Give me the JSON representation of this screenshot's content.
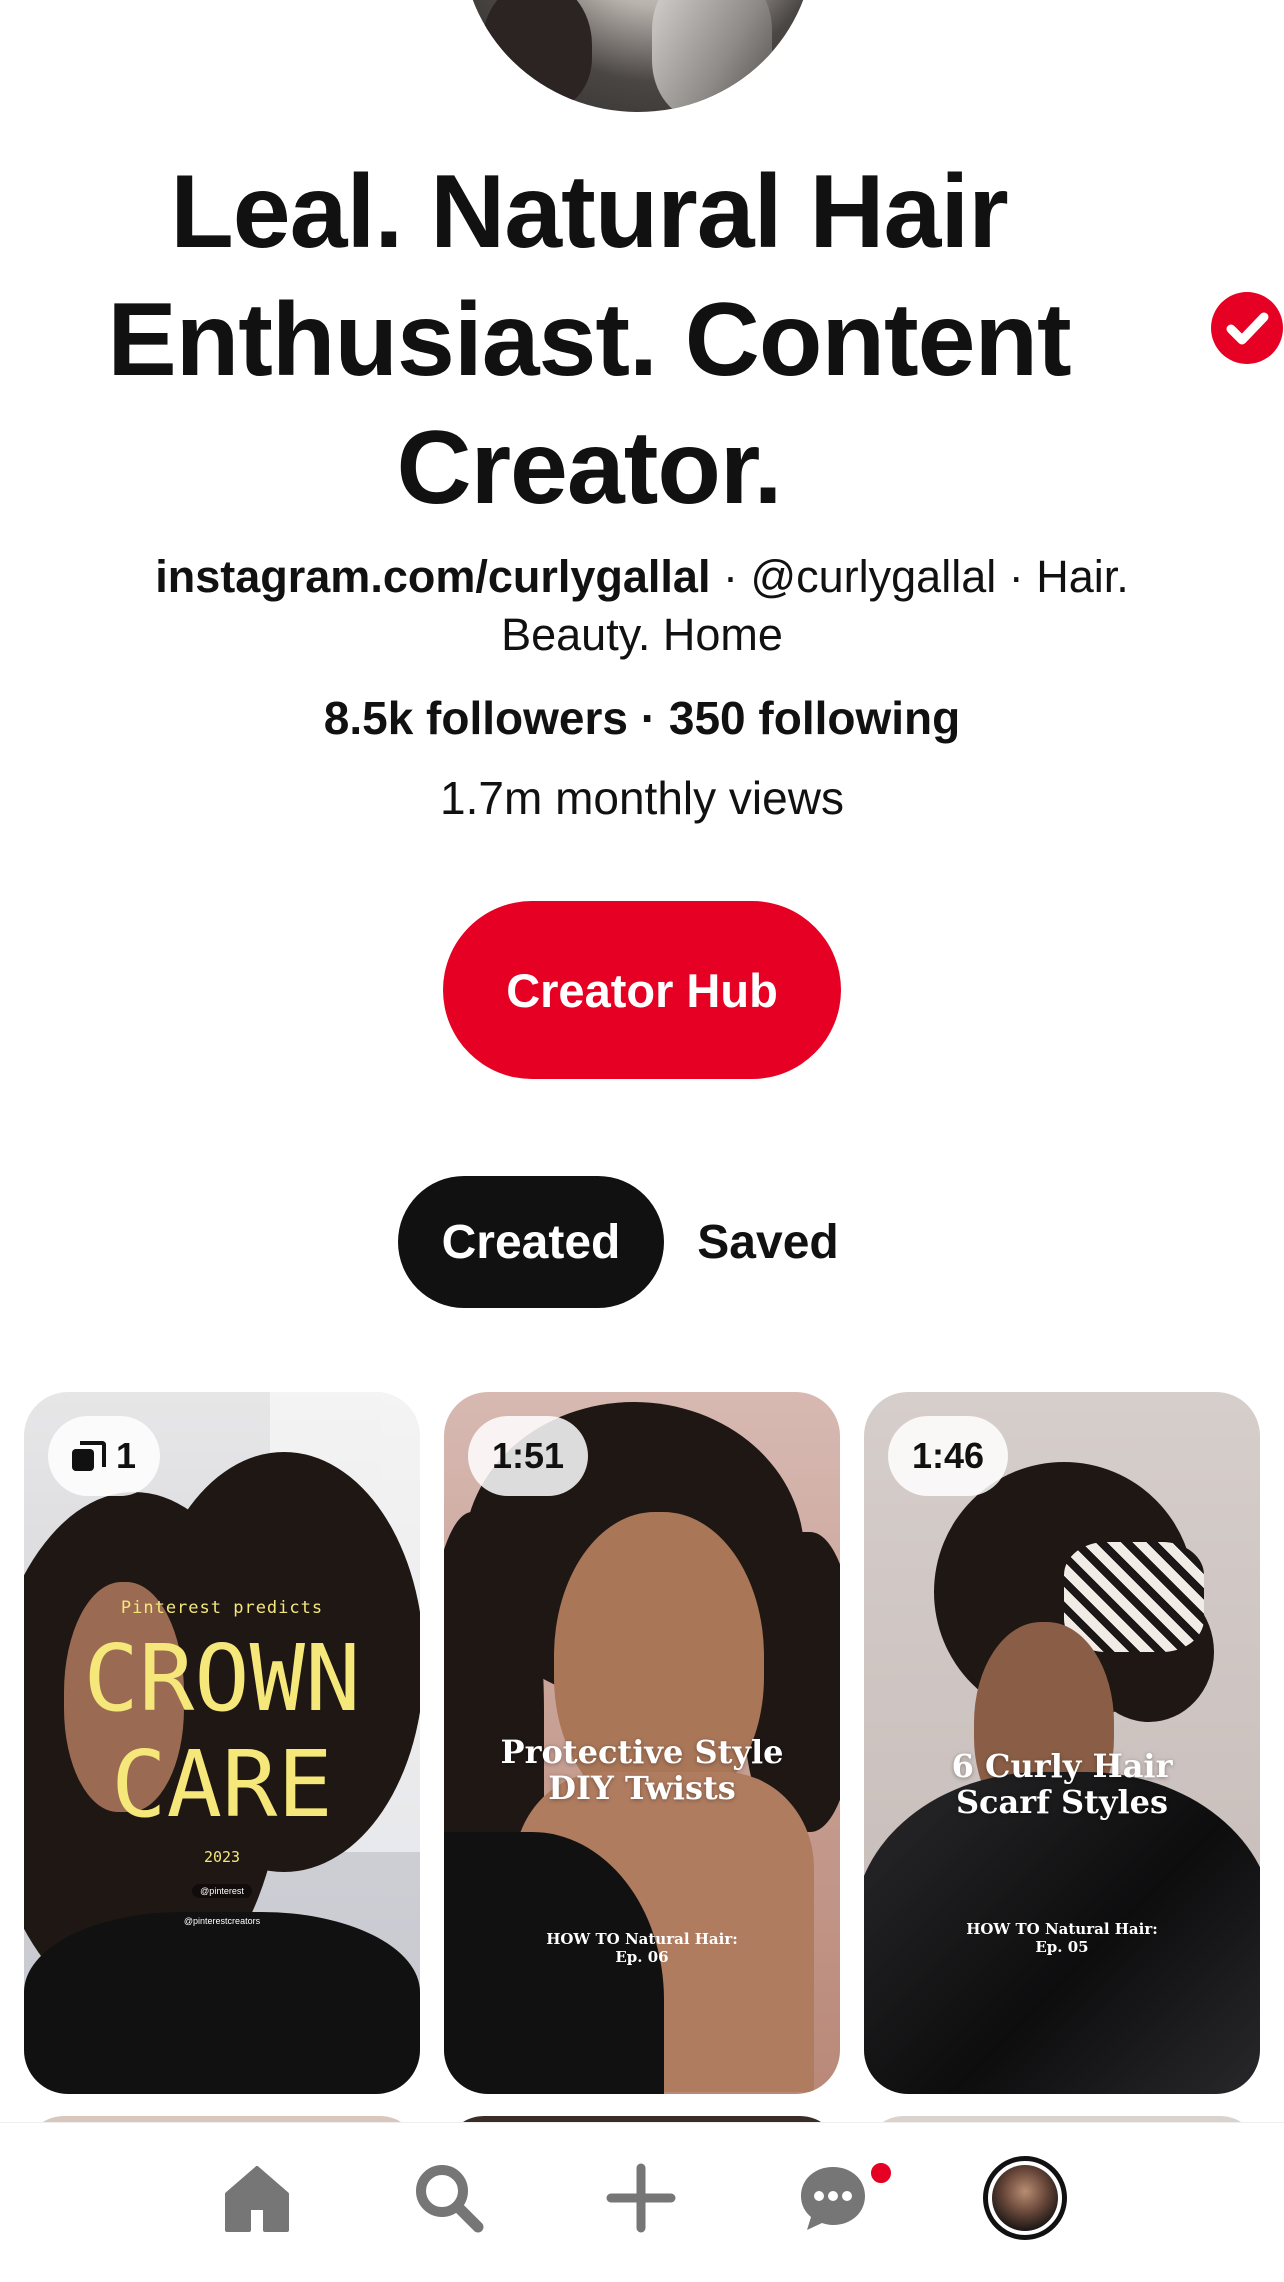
{
  "profile": {
    "name": "Leal. Natural Hair Enthusiast. Content Creator.",
    "verified": true,
    "bio_link": "instagram.com/curlygallal",
    "bio_rest": " · @curlygallal · Hair. Beauty. Home",
    "followers": "8.5k followers",
    "stats_separator": " · ",
    "following": "350 following",
    "monthly_views": "1.7m monthly views"
  },
  "actions": {
    "creator_hub": "Creator Hub"
  },
  "tabs": {
    "created": "Created",
    "saved": "Saved",
    "selected": "created"
  },
  "pins": [
    {
      "badge": "1",
      "badge_icon": "stack-icon",
      "overlay_small": "Pinterest predicts",
      "overlay_big_1": "CROWN",
      "overlay_big_2": "CARE",
      "overlay_year": "2023",
      "overlay_handle_1": "@pinterest",
      "overlay_handle_2": "@pinterestcreators"
    },
    {
      "badge": "1:51",
      "title_1": "Protective Style",
      "title_2": "DIY Twists",
      "sub_1": "HOW TO Natural Hair:",
      "sub_2": "Ep. 06"
    },
    {
      "badge": "1:46",
      "title_1": "6 Curly Hair",
      "title_2": "Scarf Styles",
      "sub_1": "HOW TO Natural Hair:",
      "sub_2": "Ep. 05"
    }
  ],
  "nav": {
    "items": [
      "home-icon",
      "search-icon",
      "plus-icon",
      "messages-icon",
      "profile-avatar"
    ],
    "messages_has_notification": true
  },
  "colors": {
    "brand_red": "#e60023",
    "text": "#111111",
    "pin_yellow": "#f5e77a"
  }
}
